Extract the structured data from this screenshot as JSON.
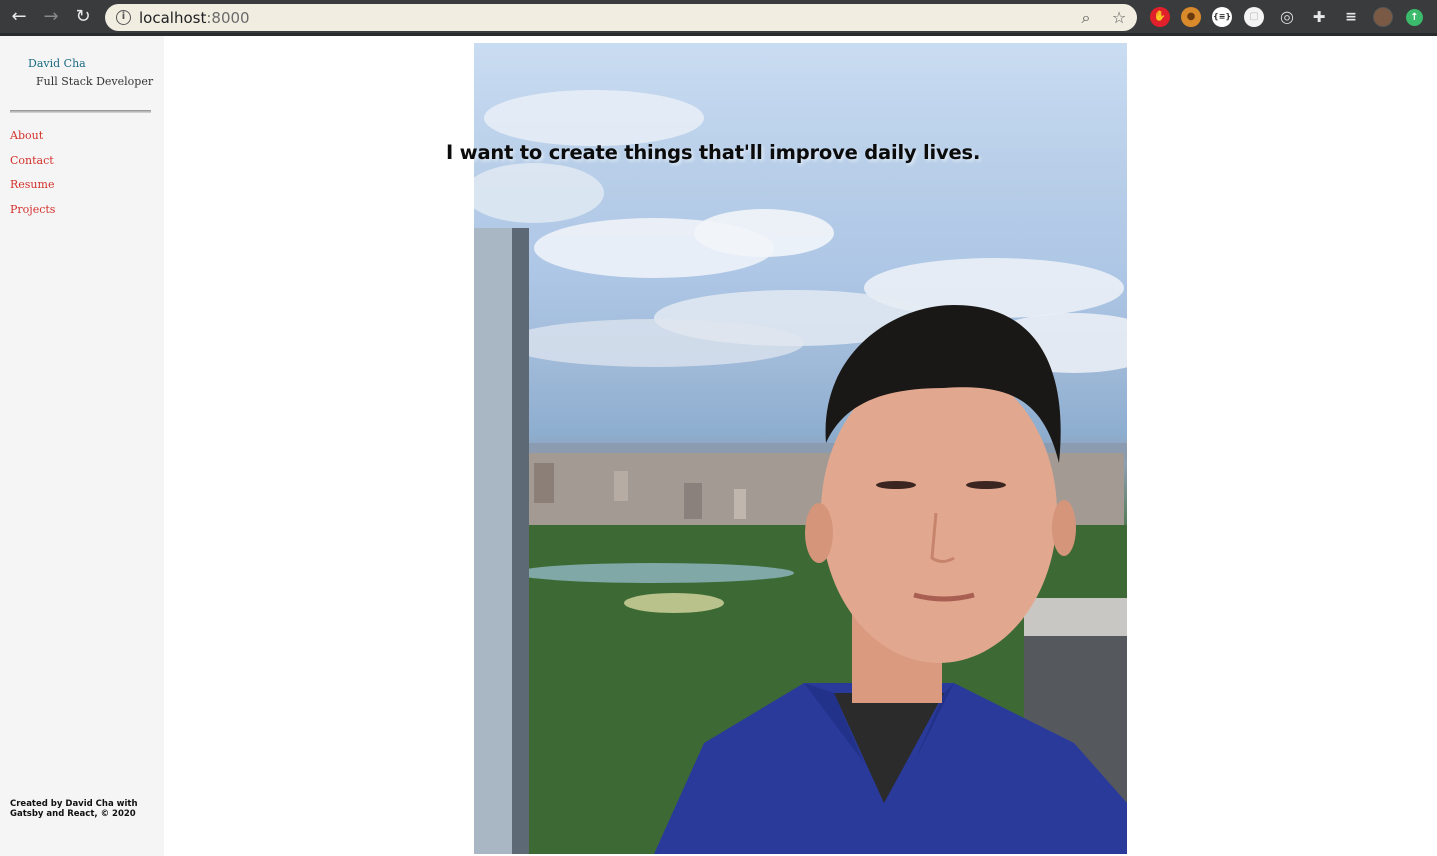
{
  "browser": {
    "url_host": "localhost",
    "url_port": ":8000",
    "icons": {
      "back": "back-arrow-icon",
      "forward": "forward-arrow-icon",
      "reload": "reload-icon",
      "site_info": "info-icon",
      "zoom": "zoom-icon",
      "bookmark": "star-icon",
      "extensions": "puzzle-icon",
      "media": "media-queue-icon",
      "profile": "avatar",
      "update": "update-arrow-icon"
    },
    "extension_labels": {
      "json": "{≡}"
    }
  },
  "sidebar": {
    "name": "David Cha",
    "role": "Full Stack Developer",
    "nav": [
      {
        "label": "About"
      },
      {
        "label": "Contact"
      },
      {
        "label": "Resume"
      },
      {
        "label": "Projects"
      }
    ],
    "footer": "Created by David Cha with Gatsby and React, © 2020"
  },
  "hero": {
    "tagline": "I want to create things that'll improve daily lives."
  },
  "colors": {
    "accent_link": "#d2322d",
    "brand_name": "#1b6b82",
    "sidebar_bg": "#f5f5f5",
    "chrome_bg": "#3a3b3d",
    "omnibox_bg": "#f1ede1"
  }
}
